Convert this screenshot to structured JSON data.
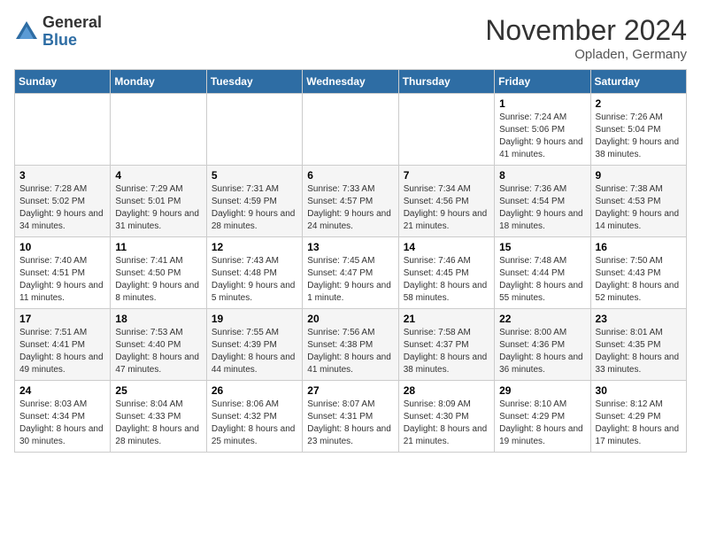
{
  "logo": {
    "general": "General",
    "blue": "Blue"
  },
  "title": "November 2024",
  "location": "Opladen, Germany",
  "days_of_week": [
    "Sunday",
    "Monday",
    "Tuesday",
    "Wednesday",
    "Thursday",
    "Friday",
    "Saturday"
  ],
  "weeks": [
    [
      {
        "day": "",
        "info": ""
      },
      {
        "day": "",
        "info": ""
      },
      {
        "day": "",
        "info": ""
      },
      {
        "day": "",
        "info": ""
      },
      {
        "day": "",
        "info": ""
      },
      {
        "day": "1",
        "info": "Sunrise: 7:24 AM\nSunset: 5:06 PM\nDaylight: 9 hours and 41 minutes."
      },
      {
        "day": "2",
        "info": "Sunrise: 7:26 AM\nSunset: 5:04 PM\nDaylight: 9 hours and 38 minutes."
      }
    ],
    [
      {
        "day": "3",
        "info": "Sunrise: 7:28 AM\nSunset: 5:02 PM\nDaylight: 9 hours and 34 minutes."
      },
      {
        "day": "4",
        "info": "Sunrise: 7:29 AM\nSunset: 5:01 PM\nDaylight: 9 hours and 31 minutes."
      },
      {
        "day": "5",
        "info": "Sunrise: 7:31 AM\nSunset: 4:59 PM\nDaylight: 9 hours and 28 minutes."
      },
      {
        "day": "6",
        "info": "Sunrise: 7:33 AM\nSunset: 4:57 PM\nDaylight: 9 hours and 24 minutes."
      },
      {
        "day": "7",
        "info": "Sunrise: 7:34 AM\nSunset: 4:56 PM\nDaylight: 9 hours and 21 minutes."
      },
      {
        "day": "8",
        "info": "Sunrise: 7:36 AM\nSunset: 4:54 PM\nDaylight: 9 hours and 18 minutes."
      },
      {
        "day": "9",
        "info": "Sunrise: 7:38 AM\nSunset: 4:53 PM\nDaylight: 9 hours and 14 minutes."
      }
    ],
    [
      {
        "day": "10",
        "info": "Sunrise: 7:40 AM\nSunset: 4:51 PM\nDaylight: 9 hours and 11 minutes."
      },
      {
        "day": "11",
        "info": "Sunrise: 7:41 AM\nSunset: 4:50 PM\nDaylight: 9 hours and 8 minutes."
      },
      {
        "day": "12",
        "info": "Sunrise: 7:43 AM\nSunset: 4:48 PM\nDaylight: 9 hours and 5 minutes."
      },
      {
        "day": "13",
        "info": "Sunrise: 7:45 AM\nSunset: 4:47 PM\nDaylight: 9 hours and 1 minute."
      },
      {
        "day": "14",
        "info": "Sunrise: 7:46 AM\nSunset: 4:45 PM\nDaylight: 8 hours and 58 minutes."
      },
      {
        "day": "15",
        "info": "Sunrise: 7:48 AM\nSunset: 4:44 PM\nDaylight: 8 hours and 55 minutes."
      },
      {
        "day": "16",
        "info": "Sunrise: 7:50 AM\nSunset: 4:43 PM\nDaylight: 8 hours and 52 minutes."
      }
    ],
    [
      {
        "day": "17",
        "info": "Sunrise: 7:51 AM\nSunset: 4:41 PM\nDaylight: 8 hours and 49 minutes."
      },
      {
        "day": "18",
        "info": "Sunrise: 7:53 AM\nSunset: 4:40 PM\nDaylight: 8 hours and 47 minutes."
      },
      {
        "day": "19",
        "info": "Sunrise: 7:55 AM\nSunset: 4:39 PM\nDaylight: 8 hours and 44 minutes."
      },
      {
        "day": "20",
        "info": "Sunrise: 7:56 AM\nSunset: 4:38 PM\nDaylight: 8 hours and 41 minutes."
      },
      {
        "day": "21",
        "info": "Sunrise: 7:58 AM\nSunset: 4:37 PM\nDaylight: 8 hours and 38 minutes."
      },
      {
        "day": "22",
        "info": "Sunrise: 8:00 AM\nSunset: 4:36 PM\nDaylight: 8 hours and 36 minutes."
      },
      {
        "day": "23",
        "info": "Sunrise: 8:01 AM\nSunset: 4:35 PM\nDaylight: 8 hours and 33 minutes."
      }
    ],
    [
      {
        "day": "24",
        "info": "Sunrise: 8:03 AM\nSunset: 4:34 PM\nDaylight: 8 hours and 30 minutes."
      },
      {
        "day": "25",
        "info": "Sunrise: 8:04 AM\nSunset: 4:33 PM\nDaylight: 8 hours and 28 minutes."
      },
      {
        "day": "26",
        "info": "Sunrise: 8:06 AM\nSunset: 4:32 PM\nDaylight: 8 hours and 25 minutes."
      },
      {
        "day": "27",
        "info": "Sunrise: 8:07 AM\nSunset: 4:31 PM\nDaylight: 8 hours and 23 minutes."
      },
      {
        "day": "28",
        "info": "Sunrise: 8:09 AM\nSunset: 4:30 PM\nDaylight: 8 hours and 21 minutes."
      },
      {
        "day": "29",
        "info": "Sunrise: 8:10 AM\nSunset: 4:29 PM\nDaylight: 8 hours and 19 minutes."
      },
      {
        "day": "30",
        "info": "Sunrise: 8:12 AM\nSunset: 4:29 PM\nDaylight: 8 hours and 17 minutes."
      }
    ]
  ]
}
